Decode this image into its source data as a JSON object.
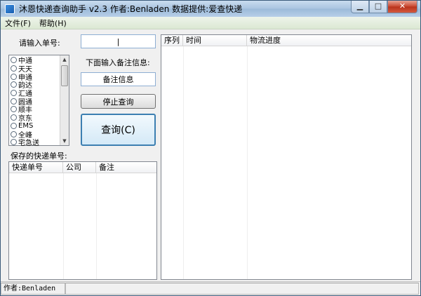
{
  "window": {
    "title": "沐恩快递查询助手 v2.3  作者:Benladen 数据提供:爱查快递",
    "controls": {
      "minimize": "▁",
      "maximize": "□",
      "close": "✕"
    }
  },
  "menu": [
    {
      "label": "文件(F)"
    },
    {
      "label": "帮助(H)"
    }
  ],
  "form": {
    "tracking_label": "请输入单号:",
    "tracking_value": "|",
    "note_label": "下面输入备注信息:",
    "note_value": "备注信息",
    "stop_button": "停止查询",
    "query_button": "查询(C)"
  },
  "couriers": [
    "中通",
    "天天",
    "申通",
    "韵达",
    "汇通",
    "圆通",
    "顺丰",
    "京东",
    "EMS",
    "全峰",
    "宅急送"
  ],
  "saved": {
    "label": "保存的快递单号:",
    "columns": [
      "快递单号",
      "公司",
      "备注"
    ]
  },
  "results": {
    "columns": [
      "序列",
      "时间",
      "物流进度"
    ]
  },
  "status": {
    "author": "作者:Benladen",
    "extra": ""
  },
  "colors": {
    "accent": "#3c7fb1",
    "title_gradient_top": "#c9dcef",
    "menu_bg": "#dbe8d3"
  }
}
